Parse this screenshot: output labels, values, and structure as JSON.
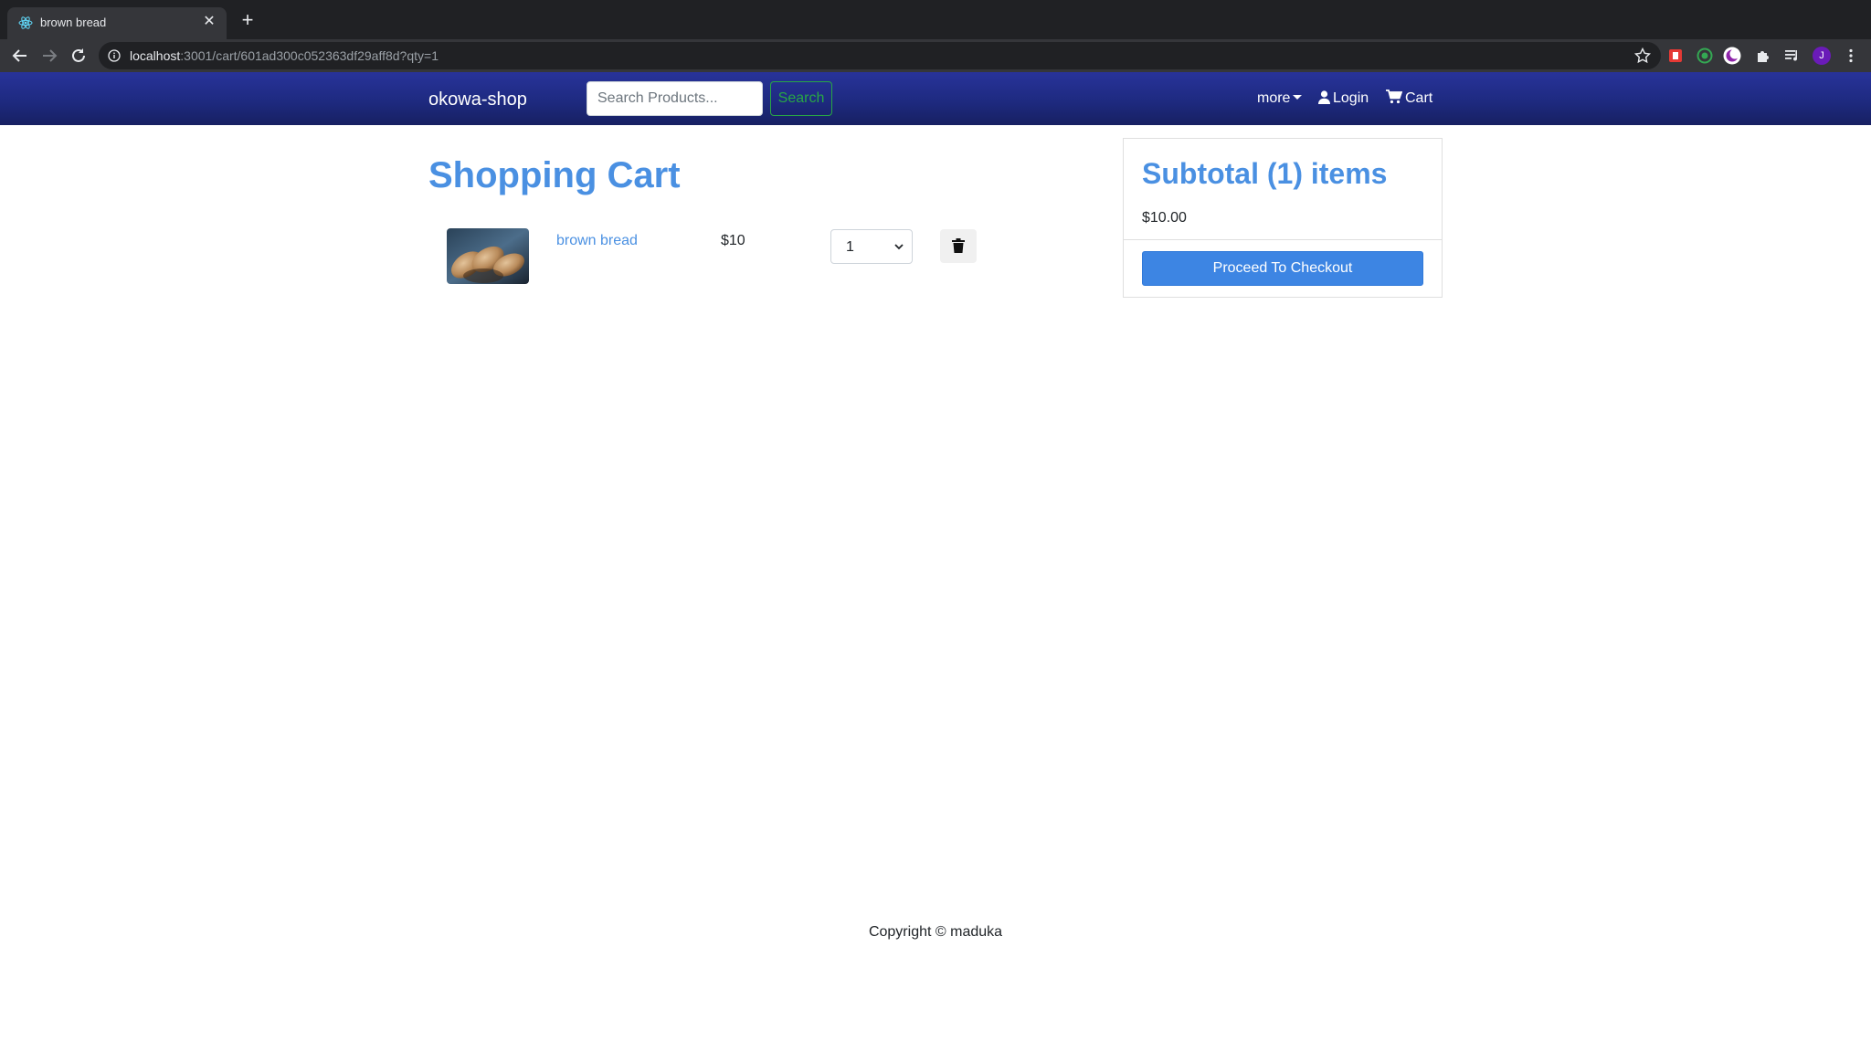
{
  "browser": {
    "tab_title": "brown bread",
    "url_host": "localhost",
    "url_path": ":3001/cart/601ad300c052363df29aff8d?qty=1",
    "profile_initial": "J"
  },
  "navbar": {
    "brand": "okowa-shop",
    "search_placeholder": "Search Products...",
    "search_button": "Search",
    "more_label": "more",
    "login_label": "Login",
    "cart_label": "Cart"
  },
  "cart": {
    "title": "Shopping Cart",
    "items": [
      {
        "name": "brown bread",
        "price": "$10",
        "qty": "1",
        "image_icon": "bread-image"
      }
    ]
  },
  "summary": {
    "title": "Subtotal (1) items",
    "amount": "$10.00",
    "checkout_label": "Proceed To Checkout"
  },
  "footer": {
    "copyright": "Copyright © maduka"
  },
  "colors": {
    "accent": "#4a90e2",
    "navbar": "#1e2a80",
    "success": "#28a745"
  }
}
